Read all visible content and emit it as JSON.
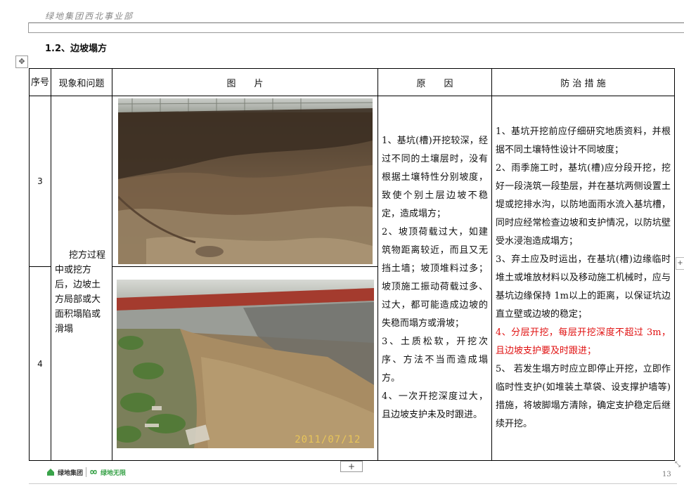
{
  "header": {
    "company_text": "绿地集团西北事业部"
  },
  "section": {
    "title": "1.2、边坡塌方"
  },
  "table": {
    "headers": {
      "seq": "序号",
      "phenomenon": "现象和问题",
      "picture": "图　　片",
      "cause": "原　　因",
      "measures": "防 治 措 施"
    },
    "rows": [
      {
        "seq": "3"
      },
      {
        "seq": "4"
      }
    ],
    "phenomenon_text": "挖方过程中或挖方后，边坡土方局部或大面积塌陷或滑塌",
    "causes": [
      "1、基坑(槽)开挖较深，经过不同的土壤层时，没有根据土壤特性分别坡度，致使个别土层边坡不稳定，造成塌方；",
      "2、坡顶荷载过大，如建筑物距离较近，而且又无挡土墙；坡顶堆料过多；坡顶施工振动荷载过多、过大，都可能造成边坡的失稳而塌方或滑坡；",
      "3、土质松软，开挖次序、方法不当而造成塌方。",
      "4、一次开挖深度过大，且边坡支护未及时跟进。"
    ],
    "measures": [
      {
        "text": "1、基坑开挖前应仔细研究地质资料，并根据不同土壤特性设计不同坡度；",
        "color": "#111111"
      },
      {
        "text": "2、雨季施工时，基坑(槽)应分段开挖，挖好一段浇筑一段垫层，并在基坑两侧设置土堤或挖排水沟，以防地面雨水流入基坑槽，同时应经常检查边坡和支护情况，以防坑壁受水浸泡造成塌方；",
        "color": "#111111"
      },
      {
        "text": "3、弃土应及时运出，在基坑(槽)边缘临时堆土或堆放材料以及移动施工机械时，应与基坑边缘保持 1m以上的距离，以保证坑边直立壁或边坡的稳定；",
        "color": "#111111"
      },
      {
        "text": "4、分层开挖，每层开挖深度不超过 3m，且边坡支护要及时跟进；",
        "color": "#e01010"
      },
      {
        "text": "5、 若发生塌方时应立即停止开挖，立即作临时性支护(如堆装土草袋、设支撑护墙等)措施，将坡脚塌方清除，确定支护稳定后继续开挖。",
        "color": "#111111"
      }
    ],
    "photo_date": "2011/07/12"
  },
  "footer": {
    "logo_brand": "绿地集团",
    "logo_brand2": "绿地无限",
    "page_number": "13"
  },
  "ui": {
    "plus_label": "+",
    "move_glyph": "✥",
    "resize_glyph": "⤡"
  },
  "colors": {
    "accent_red": "#e01010",
    "date_stamp": "#e8c55a"
  }
}
